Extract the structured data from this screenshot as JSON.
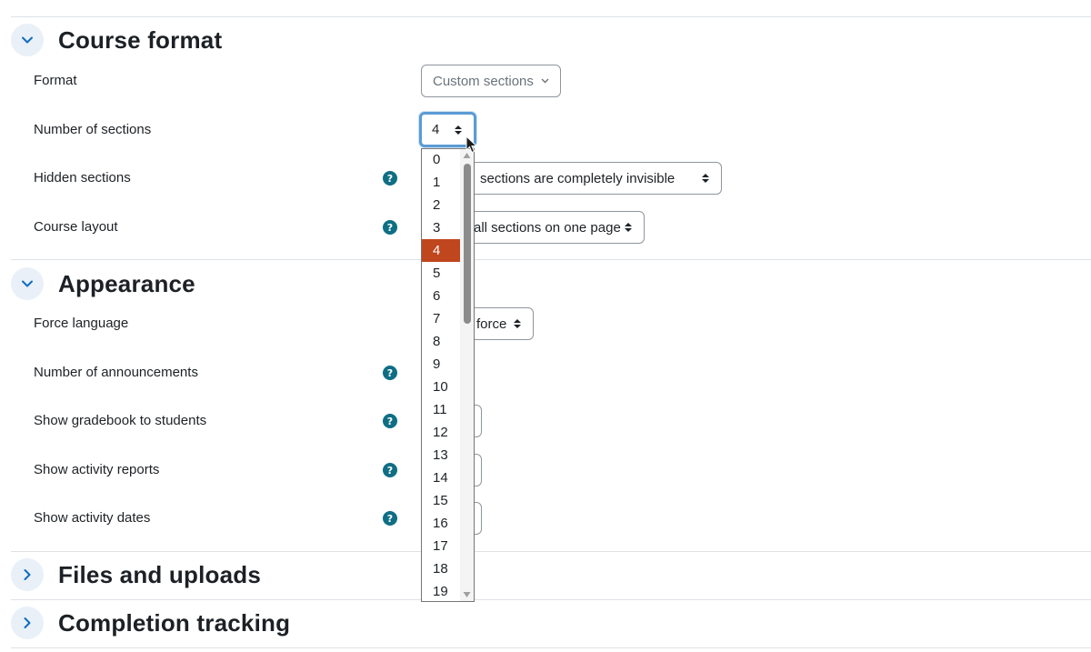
{
  "sections": {
    "course_format": "Course format",
    "appearance": "Appearance",
    "files_uploads": "Files and uploads",
    "completion_tracking": "Completion tracking"
  },
  "fields": {
    "format": {
      "label": "Format",
      "value": "Custom sections"
    },
    "number_of_sections": {
      "label": "Number of sections",
      "value": "4"
    },
    "hidden_sections": {
      "label": "Hidden sections",
      "value": "sections are completely invisible"
    },
    "course_layout": {
      "label": "Course layout",
      "value": "all sections on one page"
    },
    "force_language": {
      "label": "Force language",
      "value": "force"
    },
    "number_of_announcements": {
      "label": "Number of announcements"
    },
    "show_gradebook": {
      "label": "Show gradebook to students"
    },
    "show_activity_reports": {
      "label": "Show activity reports"
    },
    "show_activity_dates": {
      "label": "Show activity dates"
    }
  },
  "help_icon": "?",
  "dropdown": {
    "options": [
      "0",
      "1",
      "2",
      "3",
      "4",
      "5",
      "6",
      "7",
      "8",
      "9",
      "10",
      "11",
      "12",
      "13",
      "14",
      "15",
      "16",
      "17",
      "18",
      "19"
    ],
    "selected": "4"
  },
  "colors": {
    "accent": "#0f6cbf",
    "selected_option": "#c0461e",
    "help": "#0f6e84"
  }
}
